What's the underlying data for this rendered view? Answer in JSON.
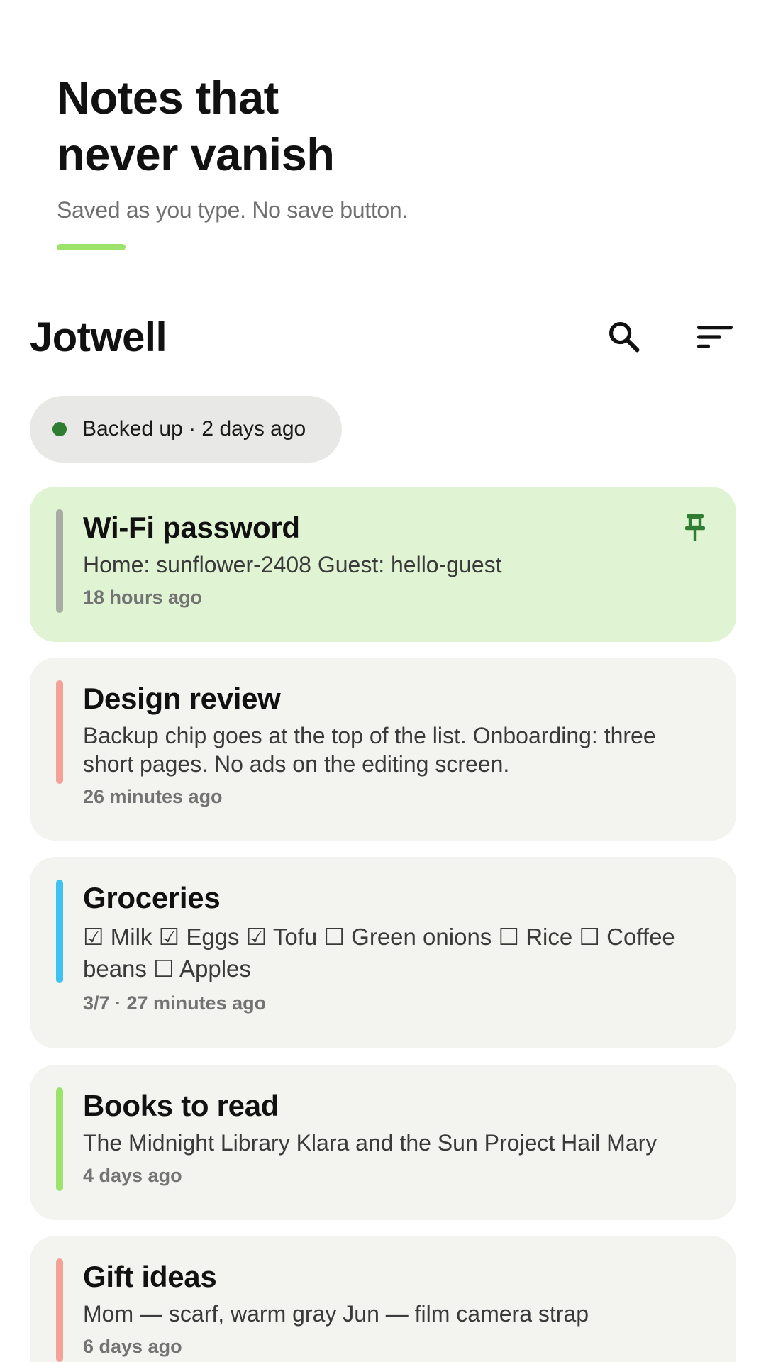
{
  "onboarding": {
    "title_line1": "Notes that",
    "title_line2": "never vanish",
    "subtitle": "Saved as you type. No save button.",
    "accent_color": "#9be36a"
  },
  "app_bar": {
    "title": "Jotwell",
    "search_icon": "search-icon",
    "sort_icon": "sort-icon"
  },
  "backup_chip": {
    "label": "Backed up · 2 days ago",
    "status_color": "#2e7d32"
  },
  "notes": [
    {
      "title": "Wi-Fi password",
      "preview": "Home: sunflower-2408 Guest: hello-guest",
      "meta": "18 hours ago",
      "pinned": true,
      "color": "#a7ada2",
      "pin_icon": "pin-icon"
    },
    {
      "title": "Design review",
      "preview": "Backup chip goes at the top of the list. Onboarding: three short pages. No ads on the editing screen.",
      "meta": "26 minutes ago",
      "color": "#f4a297"
    },
    {
      "title": "Groceries",
      "preview": "☑ Milk ☑ Eggs ☑ Tofu ☐ Green onions ☐ Rice ☐ Coffee beans ☐ Apples",
      "meta": "3/7 · 27 minutes ago",
      "color": "#3ec3f1"
    },
    {
      "title": "Books to read",
      "preview": "The Midnight Library Klara and the Sun Project Hail Mary",
      "meta": "4 days ago",
      "color": "#9be36a"
    },
    {
      "title": "Gift ideas",
      "preview": "Mom — scarf, warm gray Jun — film camera strap",
      "meta": "6 days ago",
      "color": "#f4a297"
    }
  ]
}
